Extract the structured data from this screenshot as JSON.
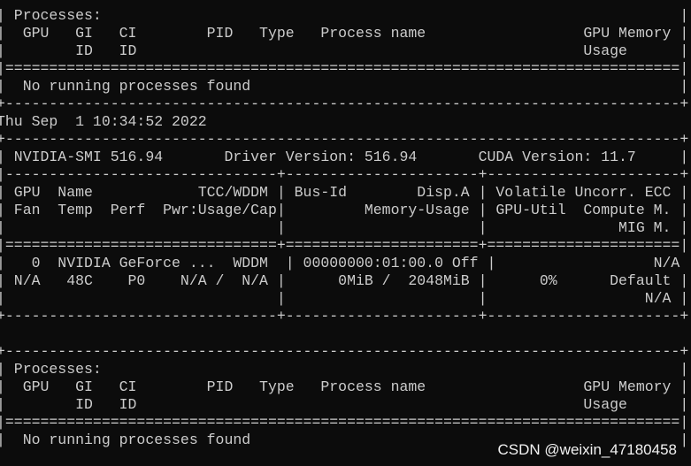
{
  "terminal": {
    "lines": [
      "| Processes:                                                                  |",
      "|  GPU   GI   CI        PID   Type   Process name                  GPU Memory |",
      "|        ID   ID                                                   Usage      |",
      "|=============================================================================|",
      "|  No running processes found                                                 |",
      "+-----------------------------------------------------------------------------+",
      "Thu Sep  1 10:34:52 2022",
      "+-----------------------------------------------------------------------------+",
      "| NVIDIA-SMI 516.94       Driver Version: 516.94       CUDA Version: 11.7     |",
      "|-------------------------------+----------------------+----------------------+",
      "| GPU  Name            TCC/WDDM | Bus-Id        Disp.A | Volatile Uncorr. ECC |",
      "| Fan  Temp  Perf  Pwr:Usage/Cap|         Memory-Usage | GPU-Util  Compute M. |",
      "|                               |                      |               MIG M. |",
      "|===============================+======================+======================|",
      "|   0  NVIDIA GeForce ...  WDDM  | 00000000:01:00.0 Off |                  N/A |",
      "| N/A   48C    P0    N/A /  N/A |      0MiB /  2048MiB |      0%      Default |",
      "|                               |                      |                  N/A |",
      "+-------------------------------+----------------------+----------------------+",
      "",
      "+-----------------------------------------------------------------------------+",
      "| Processes:                                                                  |",
      "|  GPU   GI   CI        PID   Type   Process name                  GPU Memory |",
      "|        ID   ID                                                   Usage      |",
      "|=============================================================================|",
      "|  No running processes found                                                 |"
    ]
  },
  "watermark": {
    "text": "CSDN @weixin_47180458"
  },
  "colors": {
    "background": "#0c0c0c",
    "text": "#cccccc",
    "watermark": "#f2f2f2"
  }
}
